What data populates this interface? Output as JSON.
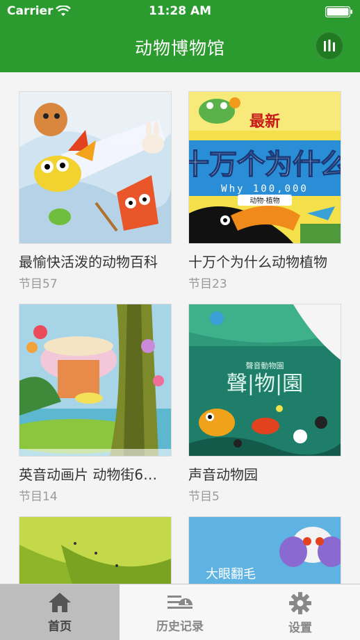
{
  "status_bar": {
    "carrier": "Carrier",
    "time": "11:28 AM"
  },
  "nav": {
    "title": "动物博物馆",
    "player_icon": "equalizer-icon"
  },
  "cards": [
    {
      "title": "最愉快活泼的动物百科",
      "subtitle": "节目57"
    },
    {
      "title": "十万个为什么动物植物",
      "subtitle": "节目23",
      "cover_text": {
        "badge": "最新",
        "main": "十万个为什么",
        "latin": "Why 100,000",
        "tag": "动物·植物"
      }
    },
    {
      "title": "英音动画片 动物街6…",
      "subtitle": "节目14"
    },
    {
      "title": "声音动物园",
      "subtitle": "节目5",
      "cover_text": {
        "main": "聲|物|園",
        "small": "聲音動物園"
      }
    },
    {
      "title": "",
      "subtitle": ""
    },
    {
      "title": "",
      "subtitle": "",
      "cover_text": {
        "main": "大眼翻毛"
      }
    }
  ],
  "tabbar": {
    "tabs": [
      {
        "label": "首页",
        "icon": "home-icon",
        "active": true
      },
      {
        "label": "历史记录",
        "icon": "history-icon",
        "active": false
      },
      {
        "label": "设置",
        "icon": "gear-icon",
        "active": false
      }
    ]
  },
  "colors": {
    "header_green": "#2b9a2f",
    "tab_active_bg": "#bdbdbd"
  }
}
